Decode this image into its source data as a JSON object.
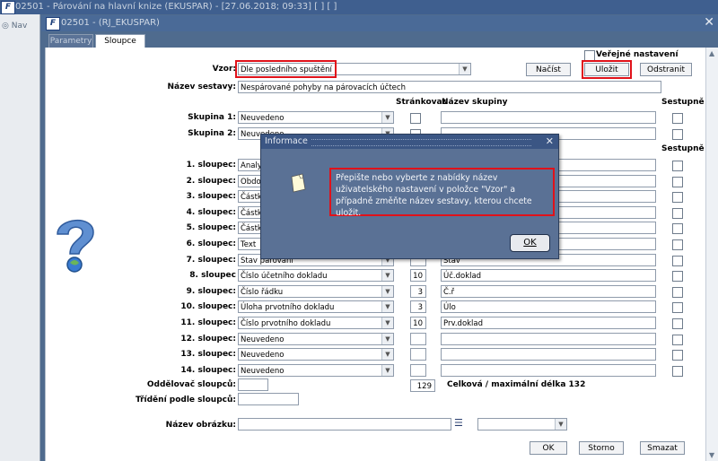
{
  "window_title": "02501 - Párování na hlavní knize (EKUSPAR) - [27.06.2018; 09:33]  [ ]  [ ]",
  "inner_title": "02501 - (RJ_EKUSPAR)",
  "nav_label": "Nav",
  "tabs": [
    {
      "label": "Parametry"
    },
    {
      "label": "Sloupce"
    }
  ],
  "public_setting_label": "Veřejné nastavení",
  "vzor": {
    "label": "Vzor:",
    "value": "Dle posledního spuštění"
  },
  "buttons": {
    "nacist": "Načíst",
    "ulozit": "Uložit",
    "odstranit": "Odstranit",
    "ok": "OK",
    "storno": "Storno",
    "smazat": "Smazat"
  },
  "nazev_sestavy": {
    "label": "Název sestavy:",
    "value": "Nespárované pohyby na párovacích účtech"
  },
  "group_headers": {
    "strankovat": "Stránkovat",
    "nazev_skupiny": "Název skupiny",
    "sestupne": "Sestupně"
  },
  "groups": [
    {
      "label": "Skupina 1:",
      "value": "Neuvedeno"
    },
    {
      "label": "Skupina 2:",
      "value": "Neuvedeno"
    }
  ],
  "columns_header": {
    "sestupne": "Sestupně"
  },
  "columns": [
    {
      "label": "1. sloupec:",
      "value": "Analytika",
      "width": "",
      "name": ""
    },
    {
      "label": "2. sloupec:",
      "value": "Období",
      "width": "",
      "name": ""
    },
    {
      "label": "3. sloupec:",
      "value": "Částka",
      "width": "",
      "name": ""
    },
    {
      "label": "4. sloupec:",
      "value": "Částka",
      "width": "",
      "name": ""
    },
    {
      "label": "5. sloupec:",
      "value": "Částka",
      "width": "",
      "name": ""
    },
    {
      "label": "6. sloupec:",
      "value": "Text",
      "width": "",
      "name": ""
    },
    {
      "label": "7. sloupec:",
      "value": "Stav párování",
      "width": "",
      "name": "Stav"
    },
    {
      "label": "8. sloupec",
      "value": "Číslo účetního dokladu",
      "width": "10",
      "name": "Úč.doklad"
    },
    {
      "label": "9. sloupec:",
      "value": "Číslo řádku",
      "width": "3",
      "name": "Č.ř"
    },
    {
      "label": "10. sloupec:",
      "value": "Úloha prvotního dokladu",
      "width": "3",
      "name": "Úlo"
    },
    {
      "label": "11. sloupec:",
      "value": "Číslo prvotního dokladu",
      "width": "10",
      "name": "Prv.doklad"
    },
    {
      "label": "12. sloupec:",
      "value": "Neuvedeno",
      "width": "",
      "name": ""
    },
    {
      "label": "13. sloupec:",
      "value": "Neuvedeno",
      "width": "",
      "name": ""
    },
    {
      "label": "14. sloupec:",
      "value": "Neuvedeno",
      "width": "",
      "name": ""
    }
  ],
  "oddelovac_label": "Oddělovač sloupců:",
  "total_width": {
    "value": "129",
    "label": "Celková / maximální délka 132"
  },
  "trideni_label": "Třídění podle sloupců:",
  "nazev_obrazku_label": "Název obrázku:",
  "modal": {
    "title": "Informace",
    "message": "Přepište nebo vyberte z nabídky název uživatelského nastavení v položce \"Vzor\" a případně změňte název sestavy, kterou chcete uložit.",
    "ok_label": "OK"
  },
  "colors": {
    "highlight": "#e0121a",
    "title_bar": "#3f5f8f",
    "modal_bg": "#5a7195"
  }
}
